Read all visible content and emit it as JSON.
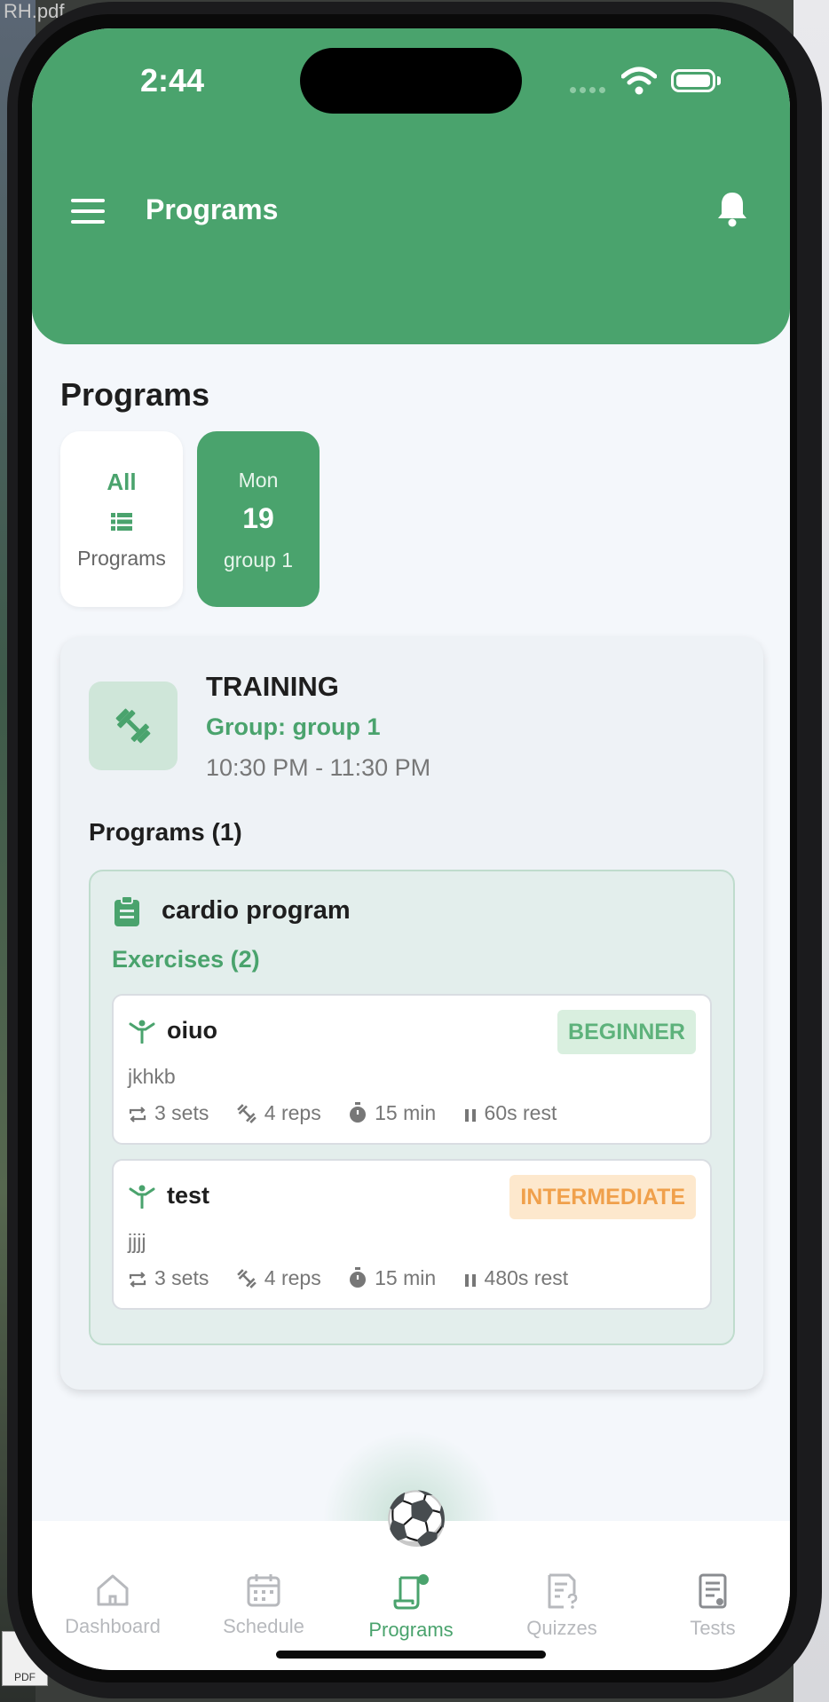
{
  "desktop": {
    "file_label": "RH.pdf",
    "pdf_label": "PDF"
  },
  "status_bar": {
    "time": "2:44"
  },
  "header": {
    "title": "Programs"
  },
  "section_title": "Programs",
  "filters": {
    "all": {
      "line1": "All",
      "line2": "Programs",
      "icon": "list-icon"
    },
    "day": {
      "weekday": "Mon",
      "date": "19",
      "group": "group 1"
    }
  },
  "training": {
    "type": "TRAINING",
    "group": "Group: group 1",
    "time": "10:30 PM - 11:30 PM",
    "programs_label": "Programs (1)",
    "program": {
      "name": "cardio program",
      "exercises_label": "Exercises (2)",
      "exercises": [
        {
          "name": "oiuo",
          "description": "jkhkb",
          "level": "BEGINNER",
          "sets": "3 sets",
          "reps": "4 reps",
          "duration": "15 min",
          "rest": "60s rest"
        },
        {
          "name": "test",
          "description": "jjjj",
          "level": "INTERMEDIATE",
          "sets": "3 sets",
          "reps": "4 reps",
          "duration": "15 min",
          "rest": "480s rest"
        }
      ]
    }
  },
  "nav": {
    "center_icon": "⚽",
    "items": [
      {
        "label": "Dashboard",
        "icon": "home-icon"
      },
      {
        "label": "Schedule",
        "icon": "calendar-icon"
      },
      {
        "label": "Programs",
        "icon": "programs-icon",
        "active": true
      },
      {
        "label": "Quizzes",
        "icon": "quiz-icon"
      },
      {
        "label": "Tests",
        "icon": "tests-icon"
      }
    ]
  },
  "colors": {
    "accent": "#4aa36d",
    "beginner": "#5db27b",
    "intermediate": "#f0a04b",
    "inactive": "#b7b9bd"
  }
}
